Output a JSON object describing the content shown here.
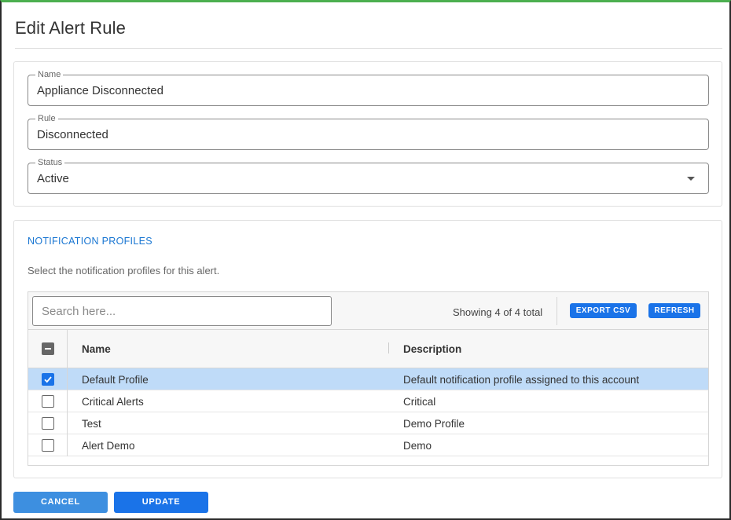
{
  "dialog": {
    "title": "Edit Alert Rule"
  },
  "form": {
    "name": {
      "label": "Name",
      "value": "Appliance Disconnected"
    },
    "rule": {
      "label": "Rule",
      "value": "Disconnected"
    },
    "status": {
      "label": "Status",
      "value": "Active"
    }
  },
  "notifications": {
    "title": "NOTIFICATION PROFILES",
    "description": "Select the notification profiles for this alert.",
    "search": {
      "placeholder": "Search here..."
    },
    "showing": "Showing 4 of 4 total",
    "export_label": "EXPORT CSV",
    "refresh_label": "REFRESH",
    "columns": {
      "name": "Name",
      "description": "Description"
    },
    "rows": [
      {
        "name": "Default Profile",
        "description": "Default notification profile assigned to this account",
        "checked": true
      },
      {
        "name": "Critical Alerts",
        "description": "Critical",
        "checked": false
      },
      {
        "name": "Test",
        "description": "Demo Profile",
        "checked": false
      },
      {
        "name": "Alert Demo",
        "description": "Demo",
        "checked": false
      }
    ]
  },
  "footer": {
    "cancel_label": "CANCEL",
    "update_label": "UPDATE"
  },
  "colors": {
    "accent": "#1a73e8",
    "selected_row": "#bfdbf8",
    "top_border": "#4caf50"
  }
}
